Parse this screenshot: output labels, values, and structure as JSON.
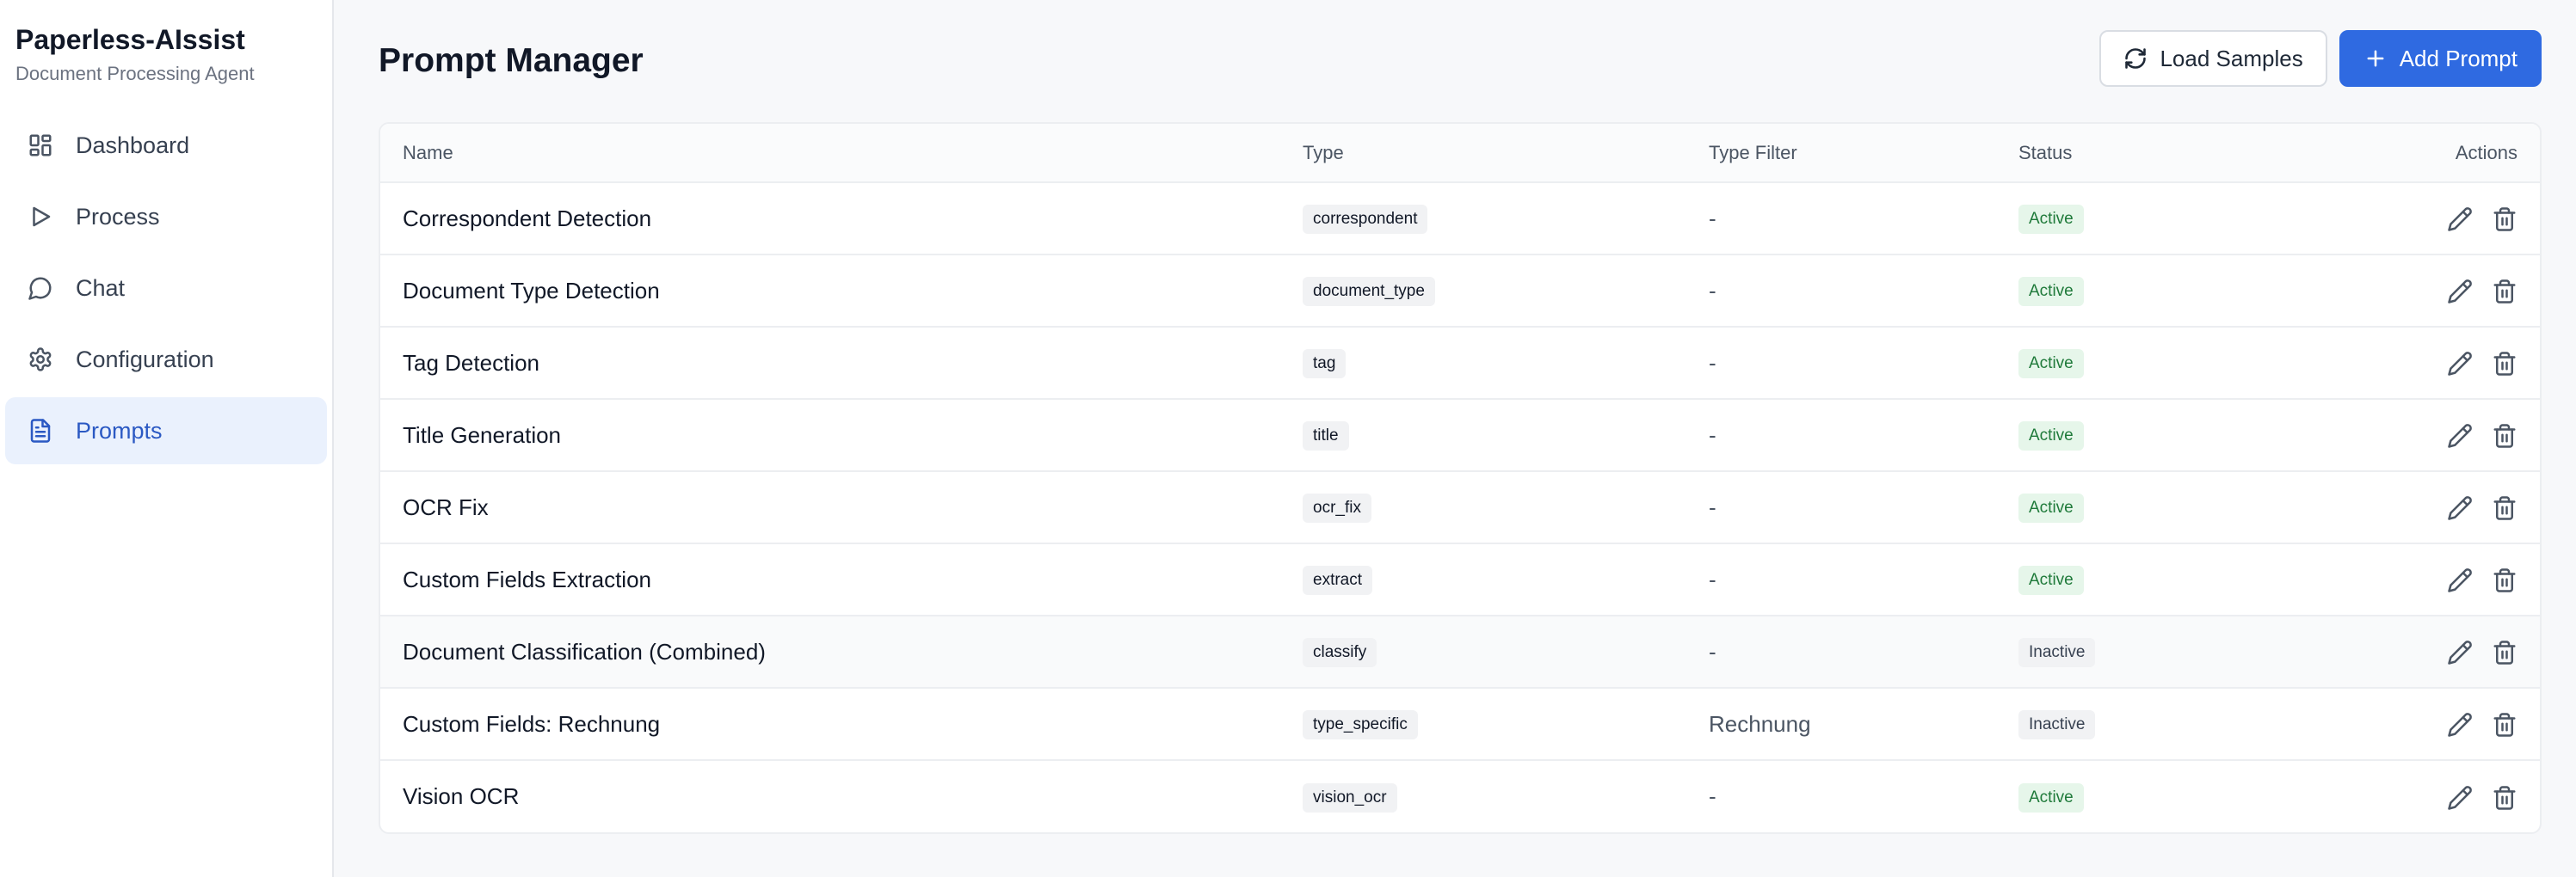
{
  "sidebar": {
    "title": "Paperless-AIssist",
    "subtitle": "Document Processing Agent",
    "items": [
      {
        "label": "Dashboard",
        "icon": "dashboard-icon"
      },
      {
        "label": "Process",
        "icon": "play-icon"
      },
      {
        "label": "Chat",
        "icon": "chat-icon"
      },
      {
        "label": "Configuration",
        "icon": "gear-icon"
      },
      {
        "label": "Prompts",
        "icon": "document-icon",
        "active": true
      }
    ]
  },
  "header": {
    "title": "Prompt Manager",
    "load_samples_label": "Load Samples",
    "add_prompt_label": "Add Prompt"
  },
  "table": {
    "columns": [
      "Name",
      "Type",
      "Type Filter",
      "Status",
      "Actions"
    ],
    "rows": [
      {
        "name": "Correspondent Detection",
        "type": "correspondent",
        "type_filter": "-",
        "status": "Active"
      },
      {
        "name": "Document Type Detection",
        "type": "document_type",
        "type_filter": "-",
        "status": "Active"
      },
      {
        "name": "Tag Detection",
        "type": "tag",
        "type_filter": "-",
        "status": "Active"
      },
      {
        "name": "Title Generation",
        "type": "title",
        "type_filter": "-",
        "status": "Active"
      },
      {
        "name": "OCR Fix",
        "type": "ocr_fix",
        "type_filter": "-",
        "status": "Active"
      },
      {
        "name": "Custom Fields Extraction",
        "type": "extract",
        "type_filter": "-",
        "status": "Active"
      },
      {
        "name": "Document Classification (Combined)",
        "type": "classify",
        "type_filter": "-",
        "status": "Inactive"
      },
      {
        "name": "Custom Fields: Rechnung",
        "type": "type_specific",
        "type_filter": "Rechnung",
        "status": "Inactive"
      },
      {
        "name": "Vision OCR",
        "type": "vision_ocr",
        "type_filter": "-",
        "status": "Active"
      }
    ]
  },
  "colors": {
    "primary": "#2f6ae1",
    "active_nav_bg": "#eaf1fd",
    "active_status_bg": "#e6f6ea",
    "active_status_text": "#1f7a3a"
  }
}
